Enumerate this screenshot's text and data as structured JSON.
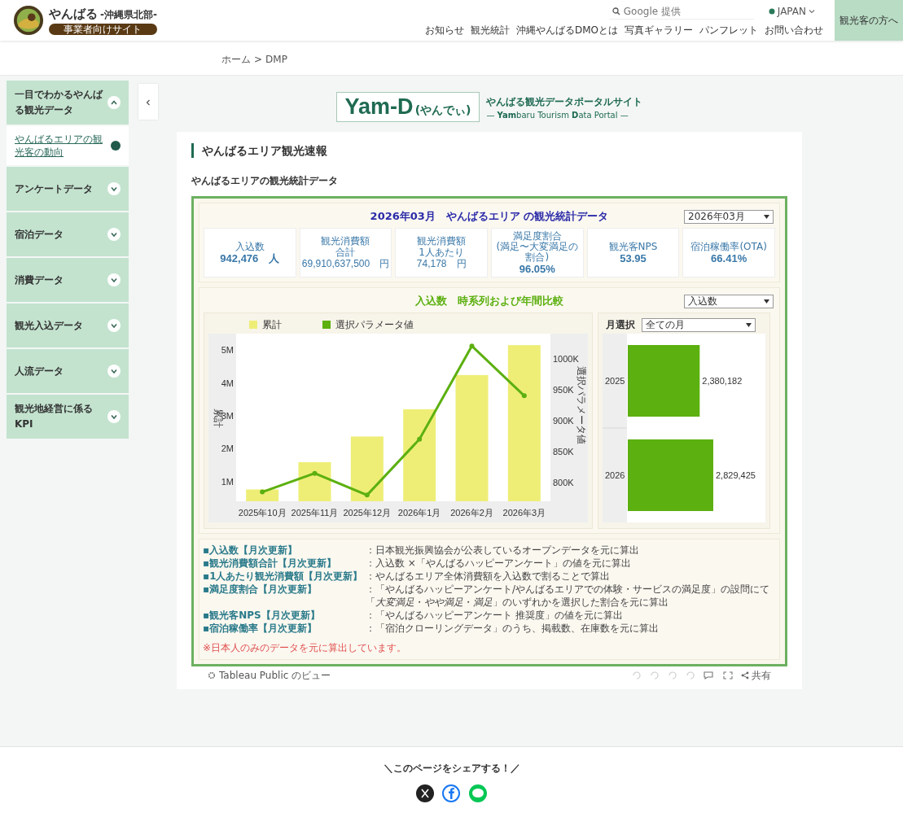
{
  "header": {
    "site_name": "やんばる",
    "site_sub": "-沖縄県北部-",
    "badge": "事業者向けサイト",
    "search": {
      "placeholder": "Google 提供"
    },
    "language": "JAPAN",
    "visitor_button": "観光客の方へ",
    "nav": [
      "お知らせ",
      "観光統計",
      "沖縄やんばるDMOとは",
      "写真ギャラリー",
      "パンフレット",
      "お問い合わせ"
    ]
  },
  "breadcrumb": {
    "items": [
      "ホーム",
      "DMP"
    ],
    "separator": ">"
  },
  "sidebar": {
    "items": [
      {
        "label": "一目でわかるやんばる観光データ",
        "expanded": true,
        "children": [
          {
            "label": "やんばるエリアの観光客の動向",
            "selected": true
          }
        ]
      },
      {
        "label": "アンケートデータ",
        "expanded": false
      },
      {
        "label": "宿泊データ",
        "expanded": false
      },
      {
        "label": "消費データ",
        "expanded": false
      },
      {
        "label": "観光入込データ",
        "expanded": false
      },
      {
        "label": "人流データ",
        "expanded": false
      },
      {
        "label": "観光地経営に係るKPI",
        "expanded": false
      }
    ]
  },
  "portal": {
    "logo_main": "Yam-D",
    "logo_sub": "(やんでぃ)",
    "title": "やんばる観光データポータルサイト",
    "subtitle": "— **Yam**baru Tourism **D**ata Portal —"
  },
  "section_title": "やんばるエリア観光速報",
  "section_subtitle": "やんばるエリアの観光統計データ",
  "dashboard": {
    "title": "2026年03月　やんばるエリア の観光統計データ",
    "period_select": "2026年03月",
    "kpis": [
      {
        "lines": [
          "入込数"
        ],
        "value": "942,476　人",
        "small": false
      },
      {
        "lines": [
          "観光消費額",
          "合計"
        ],
        "value": "69,910,637,500　円",
        "small": true
      },
      {
        "lines": [
          "観光消費額",
          "1人あたり"
        ],
        "value": "74,178　円",
        "small": true
      },
      {
        "lines": [
          "満足度割合"
        ],
        "note": "(満足〜大変満足の割合)",
        "value": "96.05%",
        "small": false
      },
      {
        "lines": [
          "観光客NPS"
        ],
        "value": "53.95",
        "small": false
      },
      {
        "lines": [
          "宿泊稼働率(OTA)"
        ],
        "value": "66.41%",
        "small": false
      }
    ],
    "chart_title": "入込数　時系列および年間比較",
    "metric_select": "入込数",
    "bars": {
      "chart_data": {
        "type": "bar",
        "ylabel": "累計",
        "categories": [
          "2025年10月",
          "2025年11月",
          "2025年12月",
          "2026年1月",
          "2026年2月",
          "2026年3月"
        ],
        "series": [
          {
            "name": "累計",
            "color": "#eeee77",
            "values": [
              760000,
              1590000,
              2370000,
              3200000,
              4240000,
              5150000
            ]
          }
        ],
        "ylim": [
          400000,
          5500000
        ],
        "yticks": [
          {
            "value": 1000000,
            "label": "1M"
          },
          {
            "value": 2000000,
            "label": "2M"
          },
          {
            "value": 3000000,
            "label": "3M"
          },
          {
            "value": 4000000,
            "label": "4M"
          },
          {
            "value": 5000000,
            "label": "5M"
          }
        ]
      }
    },
    "line": {
      "chart_data": {
        "type": "line",
        "ylabel": "選択パラメータ値",
        "series": [
          {
            "name": "選択パラメータ値",
            "color": "#5cb010",
            "marker": true,
            "values": [
              785000,
              815000,
              780000,
              870000,
              1020000,
              940000
            ]
          }
        ],
        "ylim": [
          770000,
          1040000
        ],
        "yticks": [
          {
            "value": 800000,
            "label": "800K"
          },
          {
            "value": 850000,
            "label": "850K"
          },
          {
            "value": 900000,
            "label": "900K"
          },
          {
            "value": 950000,
            "label": "950K"
          },
          {
            "value": 1000000,
            "label": "1000K"
          }
        ]
      }
    },
    "month_label": "月選択",
    "month_select": "全ての月",
    "yearly": {
      "chart_data": {
        "type": "bar",
        "orientation": "horizontal",
        "categories": [
          "2025",
          "2026"
        ],
        "data_labels": true,
        "series": [
          {
            "color": "#5cb010",
            "values": [
              2380182,
              2829425
            ],
            "value_labels": [
              "2,380,182",
              "2,829,425"
            ]
          }
        ]
      }
    },
    "notes": [
      {
        "label": "▪入込数【月次更新】",
        "text": "：日本観光振興協会が公表しているオープンデータを元に算出"
      },
      {
        "label": "▪観光消費額合計【月次更新】",
        "text": "：入込数 ×「やんばるハッピーアンケート」の値を元に算出"
      },
      {
        "label": "▪1人あたり観光消費額【月次更新】",
        "text": "：やんばるエリア全体消費額を入込数で割ることで算出"
      },
      {
        "label": "▪満足度割合【月次更新】",
        "text": "：「やんばるハッピーアンケート/やんばるエリアでの体験・サービスの満足度」の設問にて"
      },
      {
        "text": "「*大変満足*・*やや満足*・*満足*」のいずれかを選択した割合を元に算出"
      },
      {
        "label": "▪観光客NPS【月次更新】",
        "text": "：「やんばるハッピーアンケート 推奨度」の値を元に算出"
      },
      {
        "label": "▪宿泊稼働率【月次更新】",
        "text": "：「宿泊クローリングデータ」のうち、掲載数、在庫数を元に算出"
      }
    ],
    "warning": "※日本人のみのデータを元に算出しています。"
  },
  "toolbar": {
    "caption": "Tableau Public のビュー",
    "share": "共有"
  },
  "share": {
    "title": "＼このページをシェアする！／"
  }
}
